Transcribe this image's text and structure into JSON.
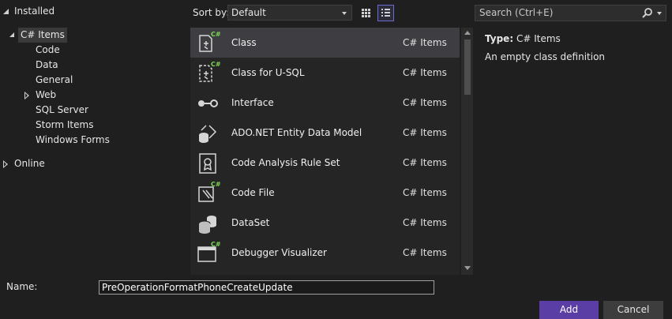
{
  "tree": {
    "installed": "Installed",
    "csharp_items": "C# Items",
    "children": [
      "Code",
      "Data",
      "General",
      "Web",
      "SQL Server",
      "Storm Items",
      "Windows Forms"
    ],
    "online": "Online"
  },
  "sortbar": {
    "label": "Sort by:",
    "value": "Default"
  },
  "templates": [
    {
      "name": "Class",
      "category": "C# Items",
      "icon": "class-icon"
    },
    {
      "name": "Class for U-SQL",
      "category": "C# Items",
      "icon": "class-usql-icon"
    },
    {
      "name": "Interface",
      "category": "C# Items",
      "icon": "interface-icon"
    },
    {
      "name": "ADO.NET Entity Data Model",
      "category": "C# Items",
      "icon": "entity-model-icon"
    },
    {
      "name": "Code Analysis Rule Set",
      "category": "C# Items",
      "icon": "rule-set-icon"
    },
    {
      "name": "Code File",
      "category": "C# Items",
      "icon": "code-file-icon"
    },
    {
      "name": "DataSet",
      "category": "C# Items",
      "icon": "dataset-icon"
    },
    {
      "name": "Debugger Visualizer",
      "category": "C# Items",
      "icon": "debugger-visualizer-icon"
    }
  ],
  "search": {
    "placeholder": "Search (Ctrl+E)"
  },
  "details": {
    "type_label": "Type:",
    "type_value": "C# Items",
    "description": "An empty class definition"
  },
  "footer": {
    "name_label": "Name:",
    "name_value": "PreOperationFormatPhoneCreateUpdate",
    "add_label": "Add",
    "cancel_label": "Cancel"
  },
  "colors": {
    "accent": "#5b3ea5",
    "badge": "#7ed957"
  }
}
